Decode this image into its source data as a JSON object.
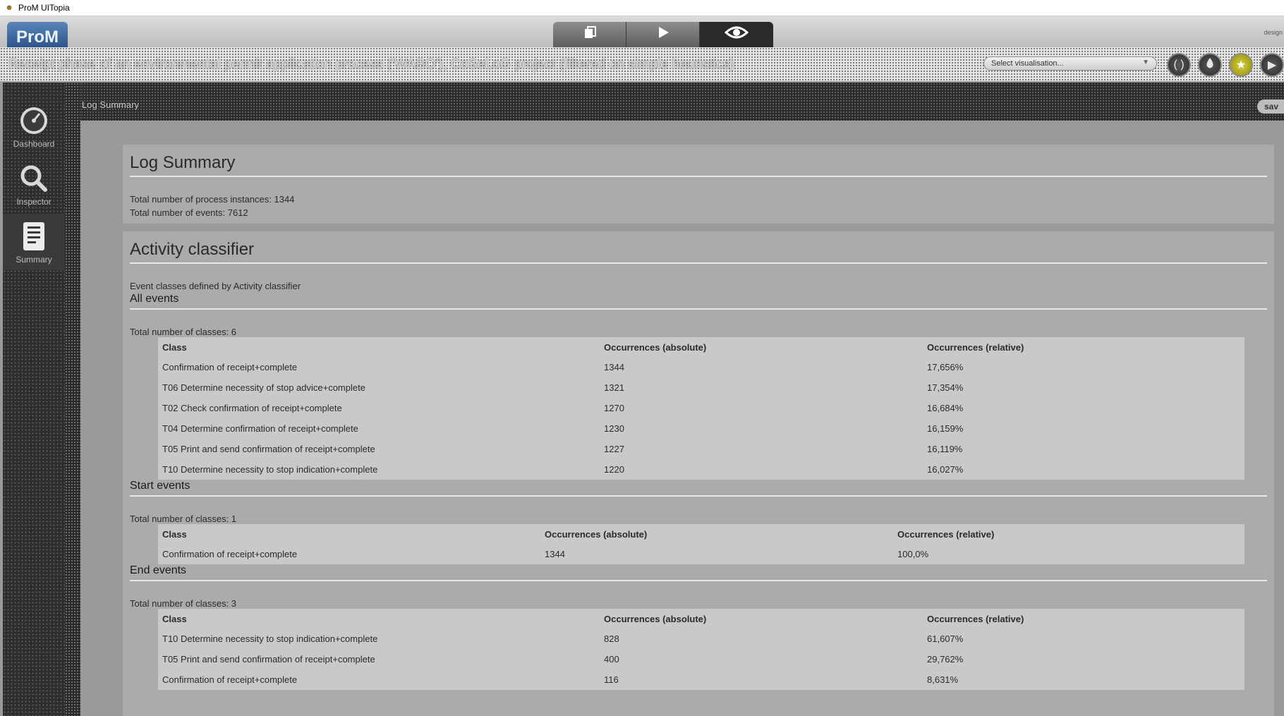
{
  "window": {
    "title": "ProM UITopia"
  },
  "toolbar": {
    "logo": "ProM",
    "designer_text": "design"
  },
  "pathbar": {
    "path": "Receipt phase of an environmental permit application process ('WABO'), CoSeLoG project (filtered on simple heuristics)",
    "visualisation_select": "Select visualisation..."
  },
  "sidebar": {
    "items": [
      {
        "label": "Dashboard",
        "icon": "dashboard-icon"
      },
      {
        "label": "Inspector",
        "icon": "magnifier-icon"
      },
      {
        "label": "Summary",
        "icon": "document-icon"
      }
    ]
  },
  "content_header": {
    "title": "Log Summary",
    "save_label": "sav"
  },
  "summary": {
    "heading": "Log Summary",
    "instances": "Total number of process instances: 1344",
    "events": "Total number of events: 7612"
  },
  "classifier": {
    "heading": "Activity classifier",
    "description": "Event classes defined by Activity classifier",
    "all_events": {
      "heading": "All events",
      "count": "Total number of classes: 6",
      "columns": [
        "Class",
        "Occurrences (absolute)",
        "Occurrences (relative)"
      ],
      "rows": [
        [
          "Confirmation of receipt+complete",
          "1344",
          "17,656%"
        ],
        [
          "T06 Determine necessity of stop advice+complete",
          "1321",
          "17,354%"
        ],
        [
          "T02 Check confirmation of receipt+complete",
          "1270",
          "16,684%"
        ],
        [
          "T04 Determine confirmation of receipt+complete",
          "1230",
          "16,159%"
        ],
        [
          "T05 Print and send confirmation of receipt+complete",
          "1227",
          "16,119%"
        ],
        [
          "T10 Determine necessity to stop indication+complete",
          "1220",
          "16,027%"
        ]
      ]
    },
    "start_events": {
      "heading": "Start events",
      "count": "Total number of classes: 1",
      "columns": [
        "Class",
        "Occurrences (absolute)",
        "Occurrences (relative)"
      ],
      "rows": [
        [
          "Confirmation of receipt+complete",
          "1344",
          "100,0%"
        ]
      ]
    },
    "end_events": {
      "heading": "End events",
      "count": "Total number of classes: 3",
      "columns": [
        "Class",
        "Occurrences (absolute)",
        "Occurrences (relative)"
      ],
      "rows": [
        [
          "T10 Determine necessity to stop indication+complete",
          "828",
          "61,607%"
        ],
        [
          "T05 Print and send confirmation of receipt+complete",
          "400",
          "29,762%"
        ],
        [
          "Confirmation of receipt+complete",
          "116",
          "8,631%"
        ]
      ]
    }
  }
}
